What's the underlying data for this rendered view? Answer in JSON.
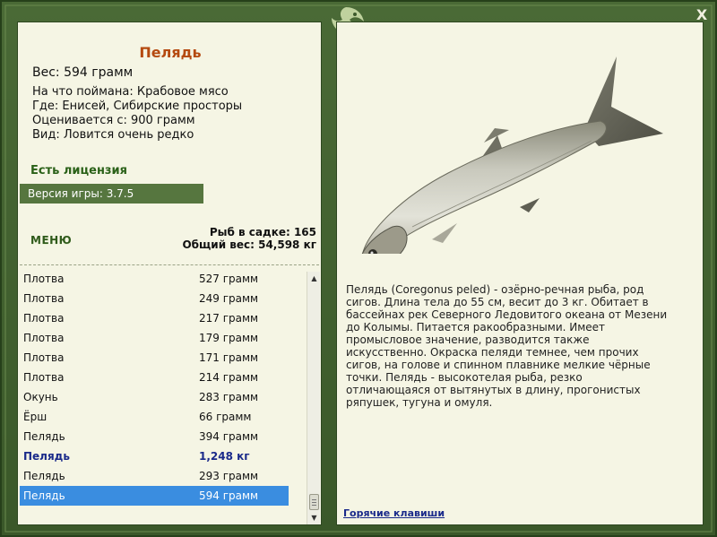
{
  "fish": {
    "title": "Пелядь",
    "weight": "Вес: 594 грамм",
    "bait": "На что поймана: Крабовое мясо",
    "location": "Где: Енисей, Сибирские просторы",
    "rated": "Оценивается с: 900 грамм",
    "rarity": "Вид: Ловится очень редко"
  },
  "license": "Есть лицензия",
  "version": "Версия игры: 3.7.5",
  "menu_label": "МЕНЮ",
  "stats": {
    "fish_in_net": "Рыб в садке: 165",
    "total_weight": "Общий вес: 54,598 кг"
  },
  "catch_list": [
    {
      "name": "Плотва",
      "weight": "527 грамм"
    },
    {
      "name": "Плотва",
      "weight": "249 грамм"
    },
    {
      "name": "Плотва",
      "weight": "217 грамм"
    },
    {
      "name": "Плотва",
      "weight": "179 грамм"
    },
    {
      "name": "Плотва",
      "weight": "171 грамм"
    },
    {
      "name": "Плотва",
      "weight": "214 грамм"
    },
    {
      "name": "Окунь",
      "weight": "283 грамм"
    },
    {
      "name": "Ёрш",
      "weight": "66 грамм"
    },
    {
      "name": "Пелядь",
      "weight": "394 грамм"
    },
    {
      "name": "Пелядь",
      "weight": "1,248 кг"
    },
    {
      "name": "Пелядь",
      "weight": "293 грамм"
    },
    {
      "name": "Пелядь",
      "weight": "594 грамм"
    }
  ],
  "description": "Пелядь (Coregonus peled) - озёрно-речная рыба, род сигов. Длина тела до 55 см, весит до 3 кг. Обитает в бассейнах рек Северного Ледовитого океана от Мезени до Колымы. Питается ракообразными. Имеет промысловое значение, разводится также искусственно. Окраска пеляди темнее, чем прочих сигов, на голове и спинном плавнике мелкие чёрные точки. Пелядь - высокотелая рыба, резко отличающаяся от вытянутых в длину, прогонистых ряпушек, тугуна и омуля.",
  "hotkeys": "Горячие клавиши",
  "close": "X",
  "colors": {
    "frame": "#3c5a2c",
    "panel": "#f5f5e4",
    "title": "#b54a10",
    "accent_green": "#56763f",
    "selection": "#3a8de0",
    "link": "#1a2a8a"
  }
}
